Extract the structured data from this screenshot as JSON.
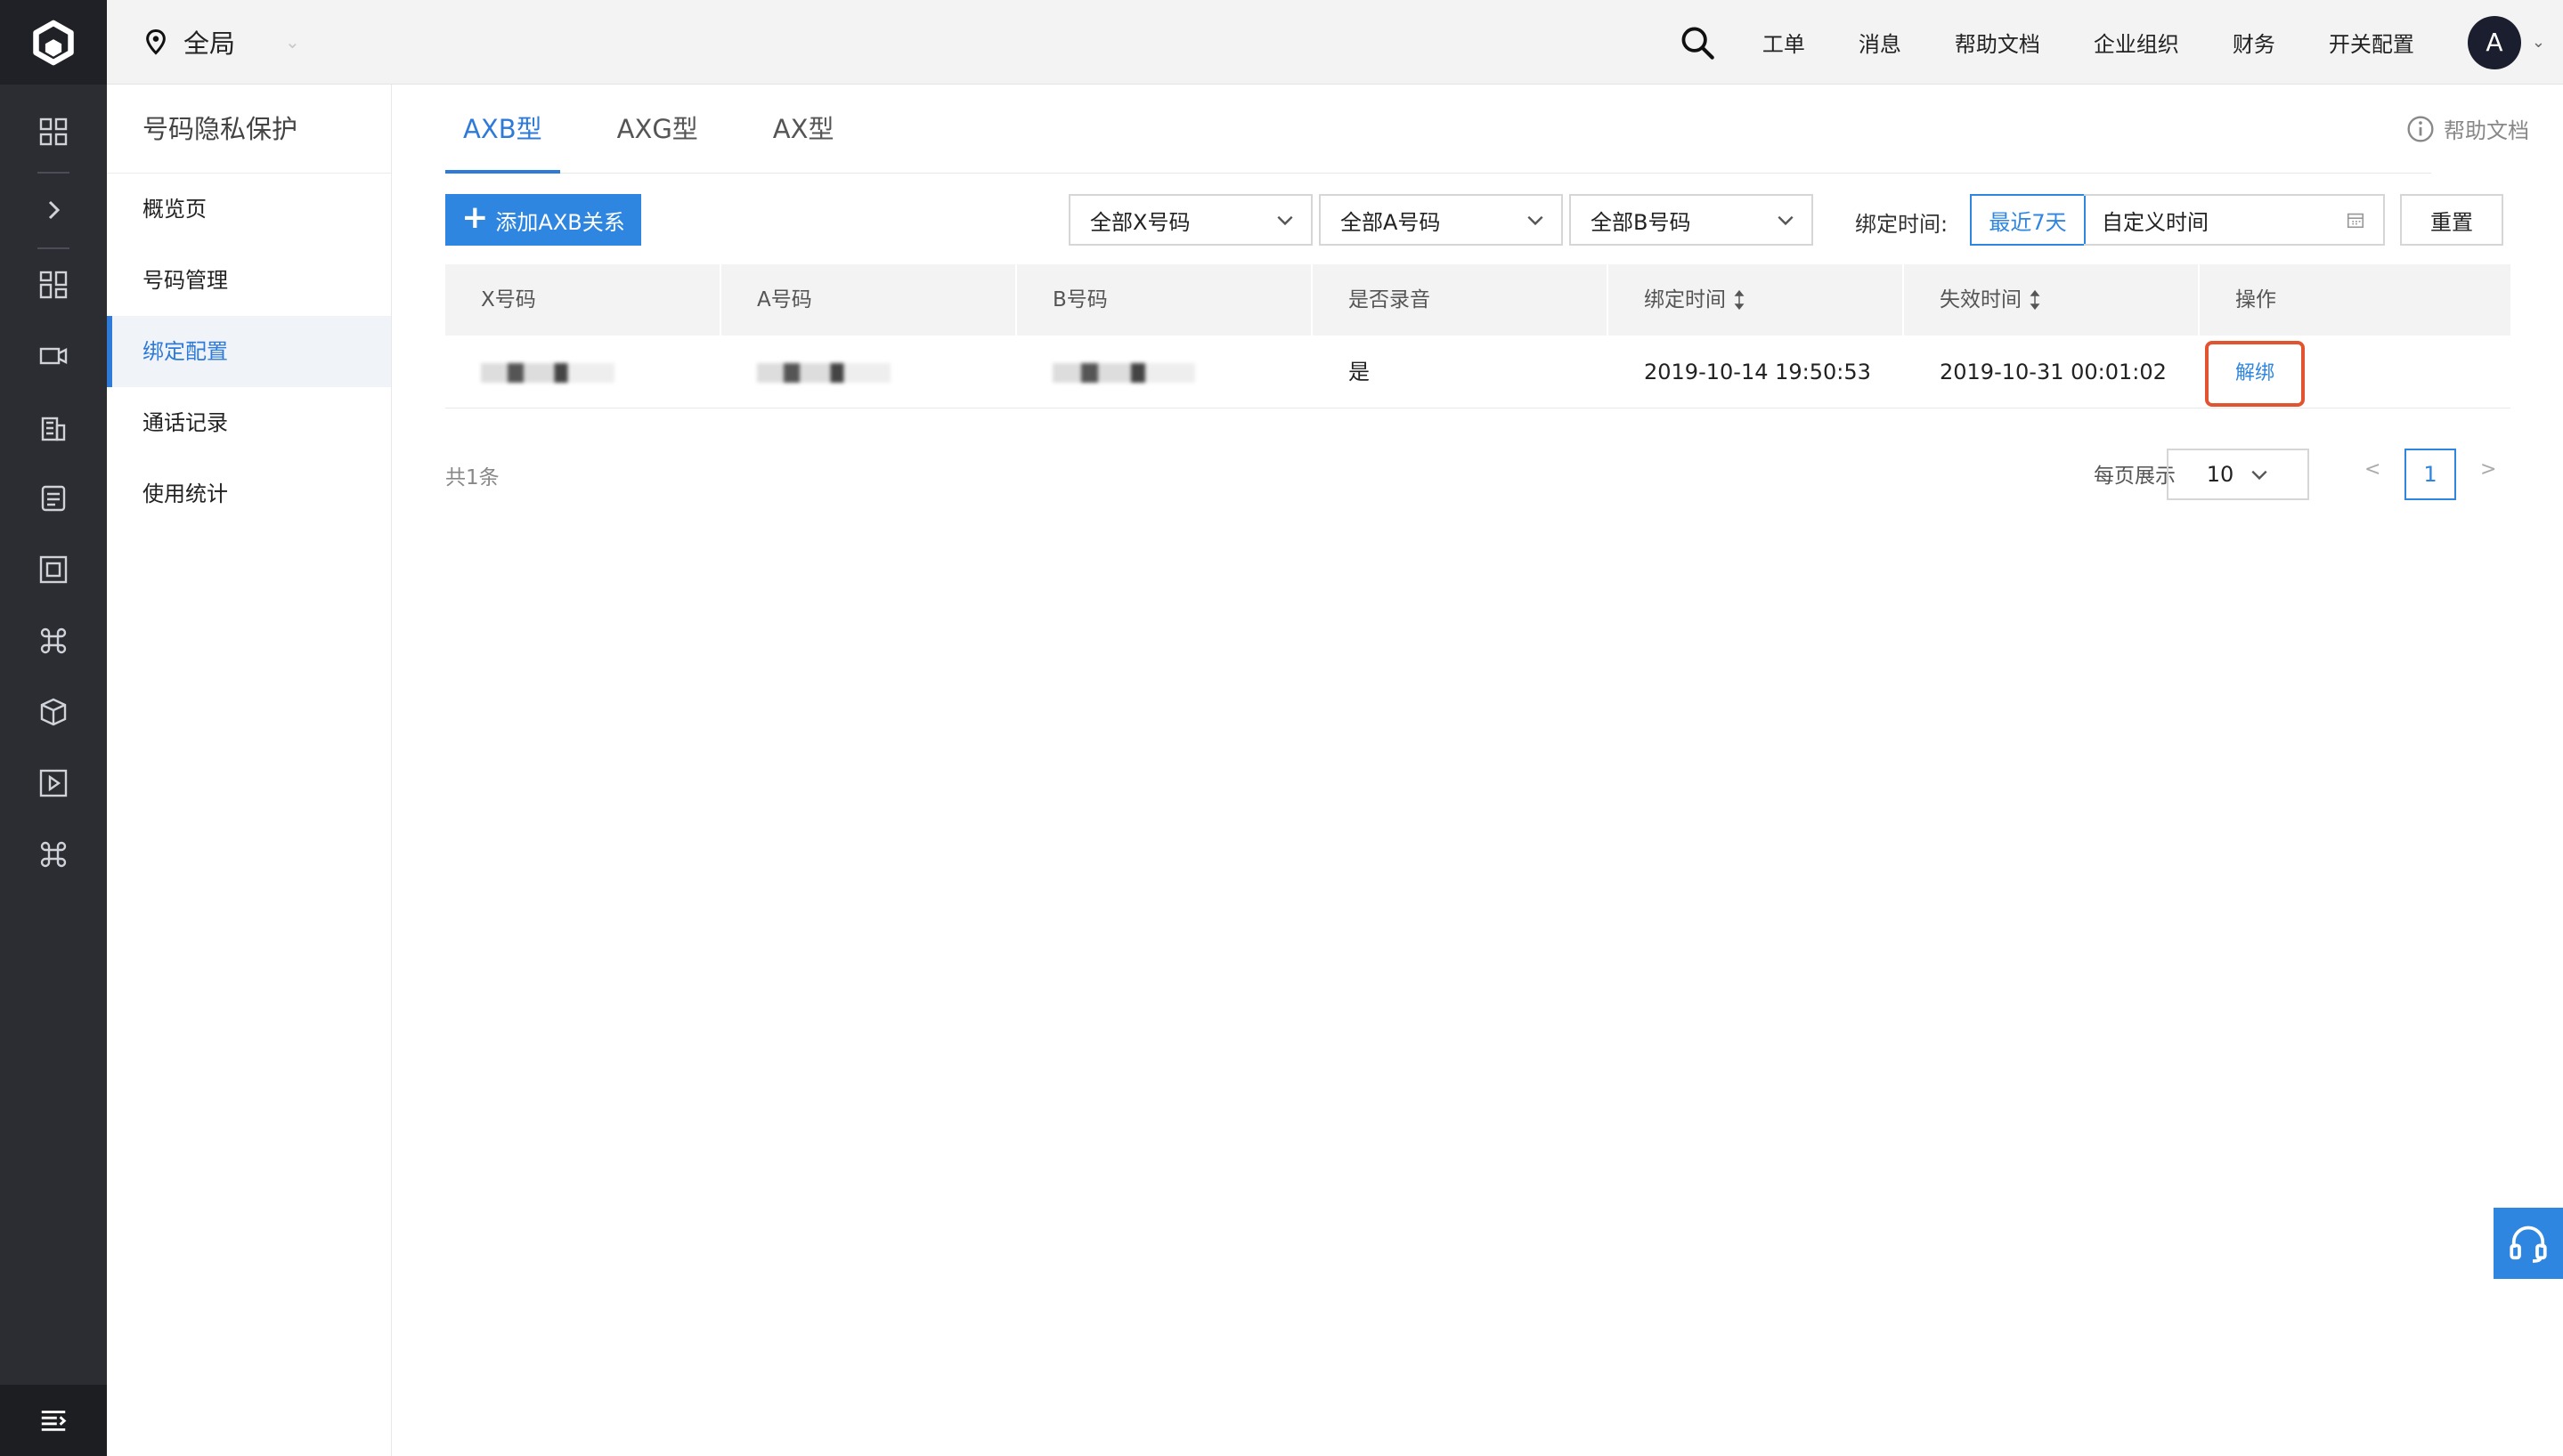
{
  "topbar": {
    "region": "全局",
    "nav": [
      "工单",
      "消息",
      "帮助文档",
      "企业组织",
      "财务",
      "开关配置"
    ],
    "avatar_letter": "A"
  },
  "sidebar": {
    "title": "号码隐私保护",
    "items": [
      {
        "label": "概览页"
      },
      {
        "label": "号码管理"
      },
      {
        "label": "绑定配置",
        "active": true
      },
      {
        "label": "通话记录"
      },
      {
        "label": "使用统计"
      }
    ]
  },
  "tabs": [
    {
      "label": "AXB型",
      "active": true
    },
    {
      "label": "AXG型"
    },
    {
      "label": "AX型"
    }
  ],
  "help_link": "帮助文档",
  "toolbar": {
    "add_button": "添加AXB关系",
    "filter_x": "全部X号码",
    "filter_a": "全部A号码",
    "filter_b": "全部B号码",
    "bind_time_label": "绑定时间:",
    "range_recent": "最近7天",
    "range_custom": "自定义时间",
    "reset": "重置"
  },
  "table": {
    "columns": [
      "X号码",
      "A号码",
      "B号码",
      "是否录音",
      "绑定时间",
      "失效时间",
      "操作"
    ],
    "rows": [
      {
        "x_number": "",
        "a_number": "",
        "b_number": "",
        "recording": "是",
        "bind_time": "2019-10-14 19:50:53",
        "expire_time": "2019-10-31 00:01:02",
        "action": "解绑"
      }
    ]
  },
  "pagination": {
    "total": "共1条",
    "per_page_label": "每页展示",
    "per_page": "10",
    "prev": "<",
    "current": "1",
    "next": ">"
  },
  "colors": {
    "accent": "#2e86e0",
    "rail_bg": "#2b2d33",
    "highlight_border": "#e2532f"
  }
}
